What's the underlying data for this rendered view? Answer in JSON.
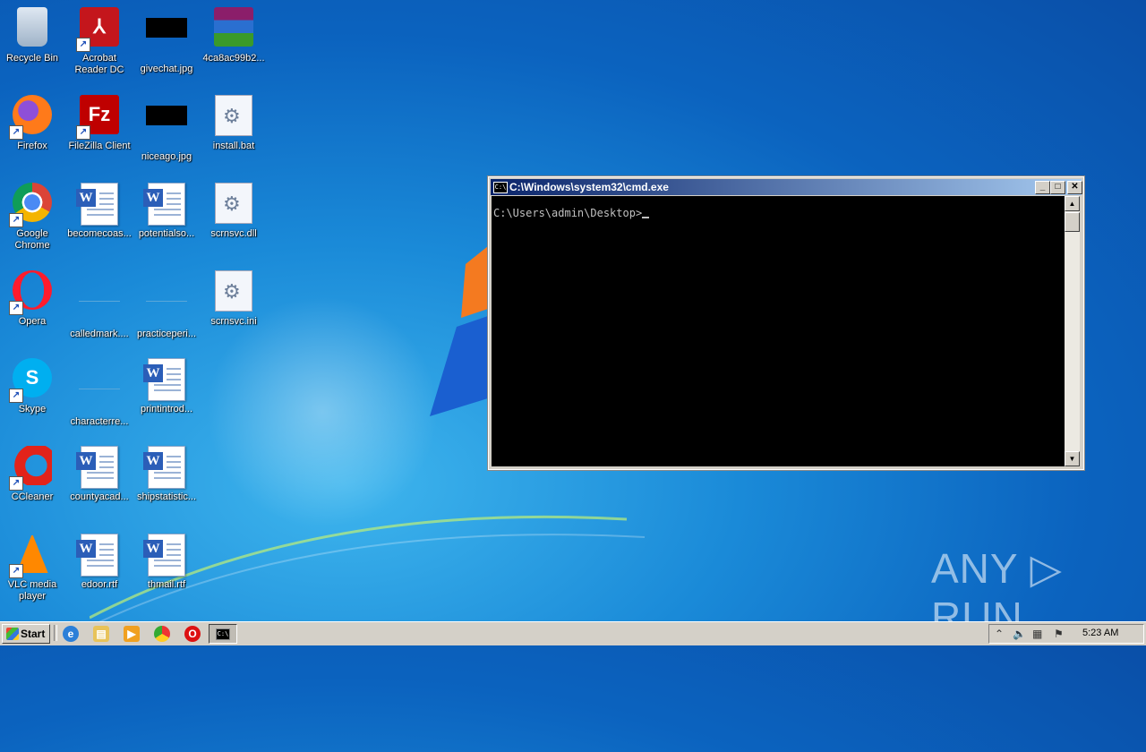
{
  "desktop": {
    "icons": [
      {
        "label": "Recycle Bin",
        "icon": "recycle-bin-icon"
      },
      {
        "label": "Acrobat Reader DC",
        "icon": "acrobat-icon"
      },
      {
        "label": "givechat.jpg",
        "icon": "image-file-icon"
      },
      {
        "label": "4ca8ac99b2...",
        "icon": "winrar-icon"
      },
      {
        "label": "Firefox",
        "icon": "firefox-icon"
      },
      {
        "label": "FileZilla Client",
        "icon": "filezilla-icon"
      },
      {
        "label": "niceago.jpg",
        "icon": "image-file-icon"
      },
      {
        "label": "install.bat",
        "icon": "batch-file-icon"
      },
      {
        "label": "Google Chrome",
        "icon": "chrome-icon"
      },
      {
        "label": "becomecoas...",
        "icon": "word-doc-icon"
      },
      {
        "label": "potentialso...",
        "icon": "word-doc-icon"
      },
      {
        "label": "scrnsvc.dll",
        "icon": "dll-file-icon"
      },
      {
        "label": "Opera",
        "icon": "opera-icon"
      },
      {
        "label": "calledmark....",
        "icon": "blank-file-icon"
      },
      {
        "label": "practiceperi...",
        "icon": "blank-file-icon"
      },
      {
        "label": "scrnsvc.ini",
        "icon": "ini-file-icon"
      },
      {
        "label": "Skype",
        "icon": "skype-icon"
      },
      {
        "label": "characterre...",
        "icon": "blank-file-icon"
      },
      {
        "label": "printintrod...",
        "icon": "word-doc-icon"
      },
      {
        "label": "CCleaner",
        "icon": "ccleaner-icon"
      },
      {
        "label": "countyacad...",
        "icon": "word-doc-icon"
      },
      {
        "label": "shipstatistic...",
        "icon": "word-doc-icon"
      },
      {
        "label": "VLC media player",
        "icon": "vlc-icon"
      },
      {
        "label": "edoor.rtf",
        "icon": "word-doc-icon"
      },
      {
        "label": "thmail.rtf",
        "icon": "word-doc-icon"
      }
    ]
  },
  "cmd_window": {
    "title": "C:\\Windows\\system32\\cmd.exe",
    "prompt": "C:\\Users\\admin\\Desktop>",
    "minimize": "_",
    "maximize": "□",
    "close": "✕"
  },
  "watermark": "ANY ▷ RUN",
  "taskbar": {
    "start_label": "Start",
    "clock": "5:23 AM"
  },
  "colors": {
    "wallpaper": "#0b63bf",
    "titlebar_start": "#0a246a",
    "titlebar_end": "#a6caf0",
    "console_bg": "#000000",
    "console_text": "#c0c0c0"
  }
}
